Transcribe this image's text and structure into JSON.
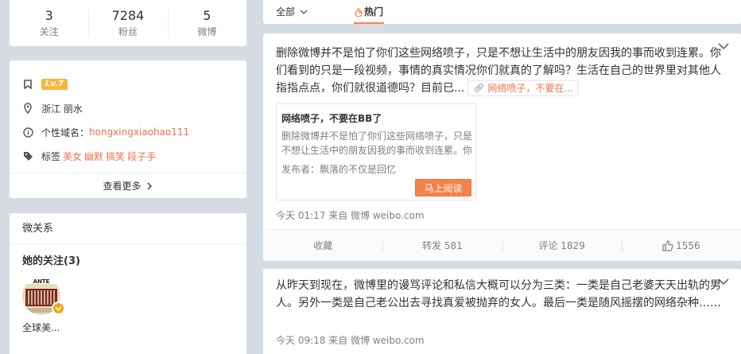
{
  "stats": [
    {
      "num": "3",
      "label": "关注"
    },
    {
      "num": "7284",
      "label": "粉丝"
    },
    {
      "num": "5",
      "label": "微博"
    }
  ],
  "profile": {
    "level": "Lv.7",
    "location": "浙江 丽水",
    "domain_label": "个性域名：",
    "domain_value": "hongxingxiaohao111",
    "tags_label": "标签",
    "tags": [
      "美女",
      "幽默",
      "搞笑",
      "段子手"
    ],
    "see_more": "查看更多"
  },
  "relations": {
    "title": "微关系",
    "following_title": "她的关注(3)",
    "following_name": "全球美..."
  },
  "tabs": {
    "all": "全部",
    "hot": "热门"
  },
  "post1": {
    "text": "删除微博并不是怕了你们这些网络喷子，只是不想让生活中的朋友因我的事而收到连累。你们看到的只是一段视频，事情的真实情况你们就真的了解吗？生活在自己的世界里对其他人指指点点，你们就很道德吗？目前已...",
    "link_text": "网络喷子，不要在...",
    "embed": {
      "title": "网络喷子，不要在BB了",
      "body": "删除微博并不是怕了你们这些网络喷子，只是不想让生活中的朋友因我的事而收到连累。你",
      "author": "发布者：飘落的不仅是回忆",
      "button": "马上阅读"
    },
    "meta": "今天 01:17 来自 微博 weibo.com",
    "actions": {
      "favorite": "收藏",
      "repost": "转发 581",
      "comment": "评论 1829",
      "like": "1556"
    }
  },
  "post2": {
    "text": "从昨天到现在，微博里的谩骂评论和私信大概可以分为三类：一类是自己老婆天天出轨的男人。另外一类是自己老公出去寻找真爱被抛弃的女人。最后一类是随风摇摆的网络杂种……",
    "meta": "今天 09:18 来自 微博 weibo.com"
  },
  "colors": {
    "accent": "#eb7350",
    "button": "#f3834b",
    "level_badge": "#f8b73e",
    "page_bg": "#d6dce2"
  }
}
